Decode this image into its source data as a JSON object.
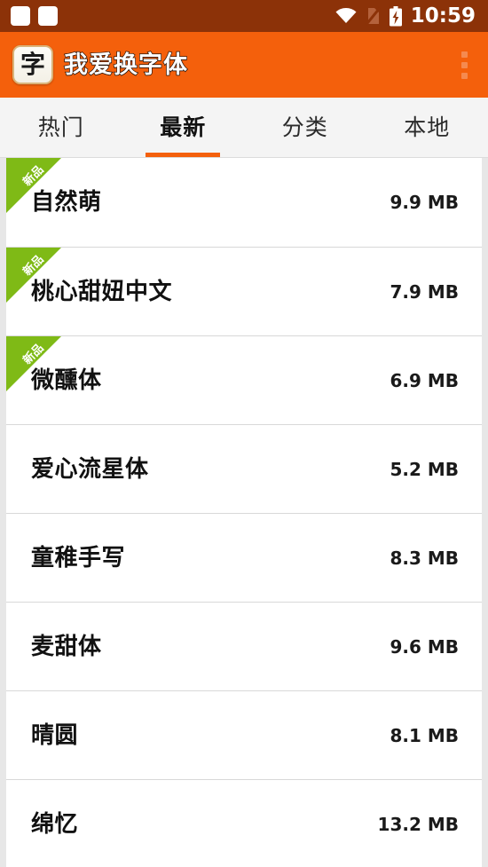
{
  "status_bar": {
    "notification_count": 2,
    "icons": [
      "wifi-icon",
      "sim-card-off-icon",
      "battery-charging-icon"
    ],
    "clock": "10:59",
    "background_color": "#8C3208"
  },
  "action_bar": {
    "app_icon_glyph": "字",
    "title": "我爱换字体",
    "overflow_label": "⋮",
    "background_color": "#F4600C"
  },
  "tabs": {
    "active_index": 1,
    "items": [
      {
        "label": "热门"
      },
      {
        "label": "最新"
      },
      {
        "label": "分类"
      },
      {
        "label": "本地"
      }
    ],
    "indicator_color": "#F4600C"
  },
  "font_list": {
    "ribbon_label": "新品",
    "ribbon_color": "#7FBA16",
    "items": [
      {
        "name": "自然萌",
        "size": "9.9 MB",
        "is_new": true
      },
      {
        "name": "桃心甜妞中文",
        "size": "7.9 MB",
        "is_new": true
      },
      {
        "name": "微醺体",
        "size": "6.9 MB",
        "is_new": true
      },
      {
        "name": "爱心流星体",
        "size": "5.2 MB",
        "is_new": false
      },
      {
        "name": "童稚手写",
        "size": "8.3 MB",
        "is_new": false
      },
      {
        "name": "麦甜体",
        "size": "9.6 MB",
        "is_new": false
      },
      {
        "name": "晴圆",
        "size": "8.1 MB",
        "is_new": false
      },
      {
        "name": "绵忆",
        "size": "13.2 MB",
        "is_new": false
      }
    ]
  }
}
